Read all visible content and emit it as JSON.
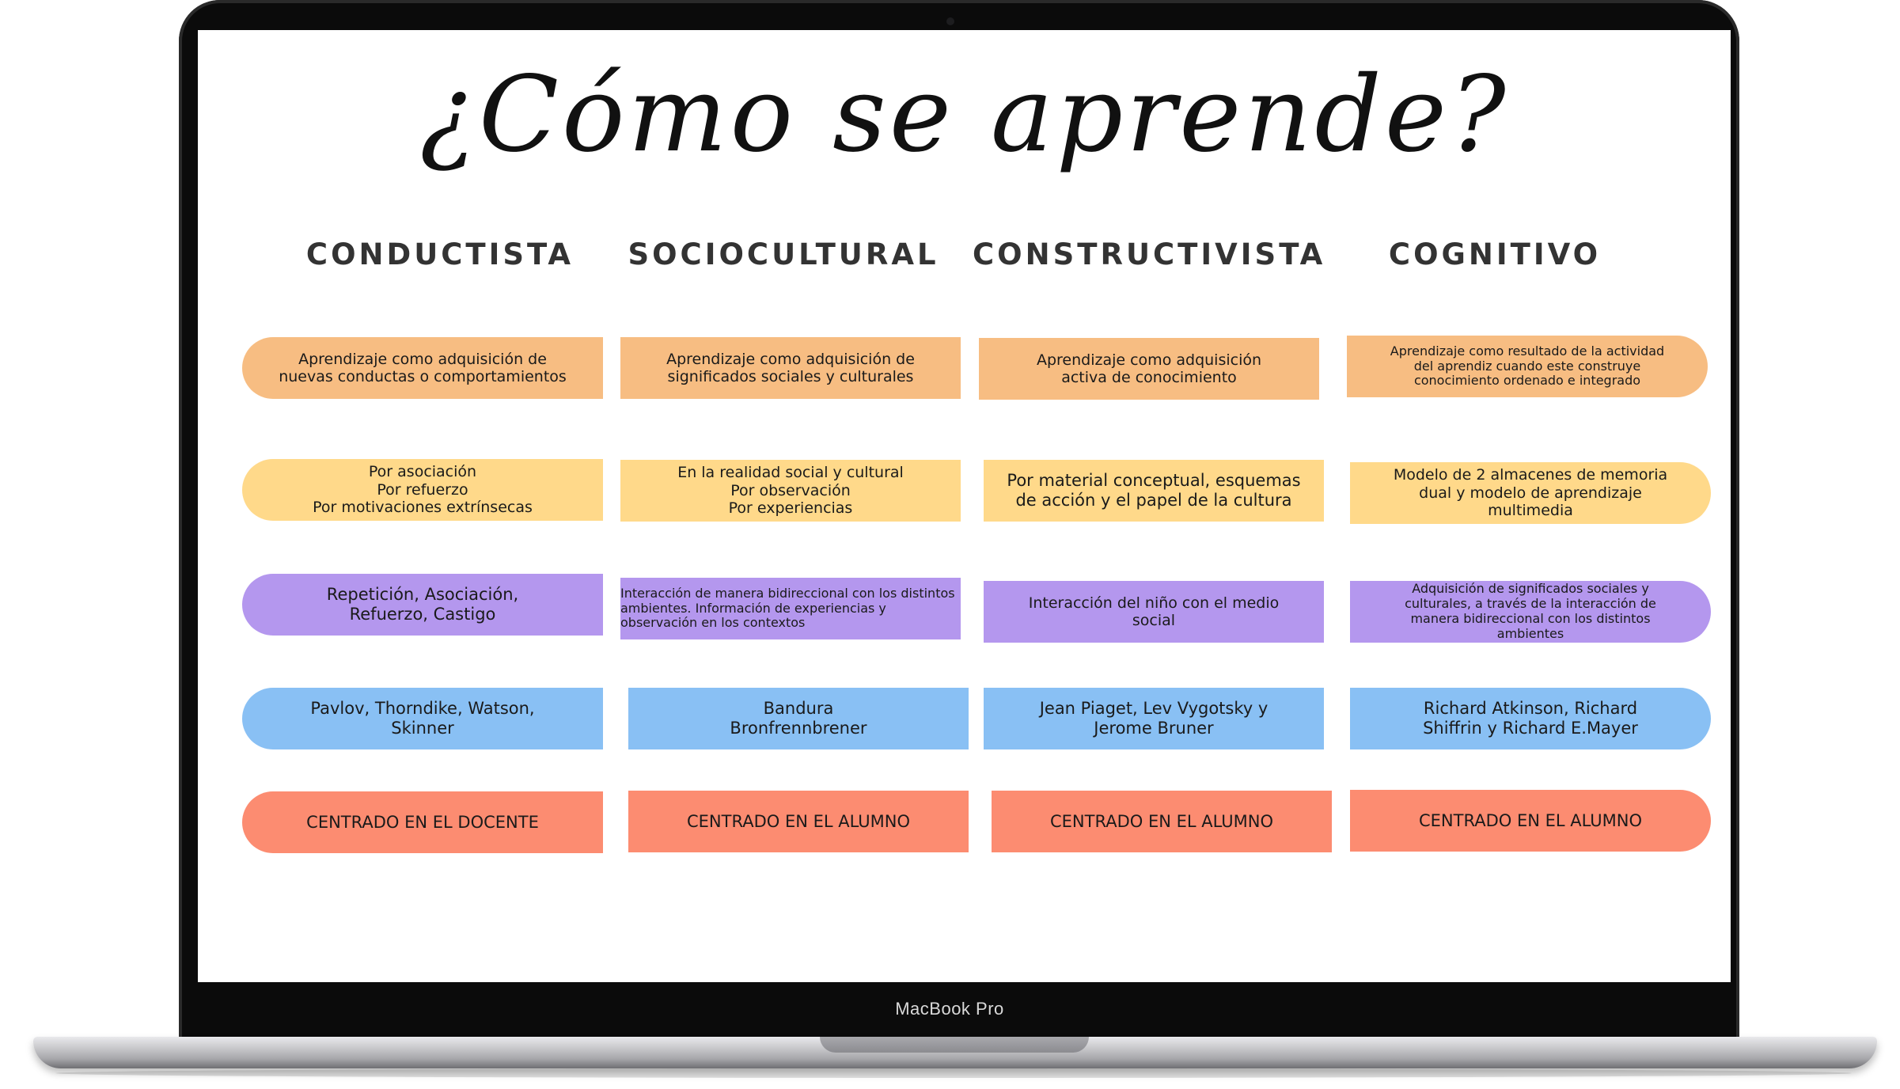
{
  "device": {
    "brand_label": "MacBook Pro"
  },
  "slide": {
    "title": "¿Cómo se aprende?",
    "columns": [
      {
        "heading": "CONDUCTISTA",
        "definition": "Aprendizaje como adquisición de\nnuevas conductas o comportamientos",
        "how": "Por asociación\nPor refuerzo\nPor motivaciones extrínsecas",
        "process": "Repetición, Asociación,\nRefuerzo, Castigo",
        "authors": "Pavlov, Thorndike, Watson,\nSkinner",
        "focus": "CENTRADO EN EL DOCENTE"
      },
      {
        "heading": "SOCIOCULTURAL",
        "definition": "Aprendizaje como adquisición de\nsignificados sociales y culturales",
        "how": "En la realidad social y cultural\nPor observación\nPor experiencias",
        "process": "Interacción de manera bidireccional con los distintos ambientes. Información de experiencias y observación en los contextos",
        "authors": "Bandura\nBronfrennbrener",
        "focus": "CENTRADO EN EL ALUMNO"
      },
      {
        "heading": "CONSTRUCTIVISTA",
        "definition": "Aprendizaje como adquisición\nactiva de conocimiento",
        "how": "Por material conceptual, esquemas\nde acción y el papel de la cultura",
        "process": "Interacción del niño con el medio\nsocial",
        "authors": "Jean Piaget, Lev Vygotsky y\nJerome Bruner",
        "focus": "CENTRADO EN EL ALUMNO"
      },
      {
        "heading": "COGNITIVO",
        "definition": "Aprendizaje como resultado de la actividad\ndel aprendiz cuando este construye\nconocimiento ordenado e integrado",
        "how": "Modelo de 2 almacenes de memoria\ndual y modelo de aprendizaje\nmultimedia",
        "process": "Adquisición de significados sociales y\nculturales, a través de la interacción de\nmanera bidireccional con los distintos\nambientes",
        "authors": "Richard Atkinson, Richard\nShiffrin y Richard E.Mayer",
        "focus": "CENTRADO EN EL ALUMNO"
      }
    ]
  },
  "colors": {
    "definition": "#f7bd82",
    "how": "#ffd98a",
    "process": "#b497ee",
    "authors": "#89c0f4",
    "focus": "#fc8c71"
  }
}
